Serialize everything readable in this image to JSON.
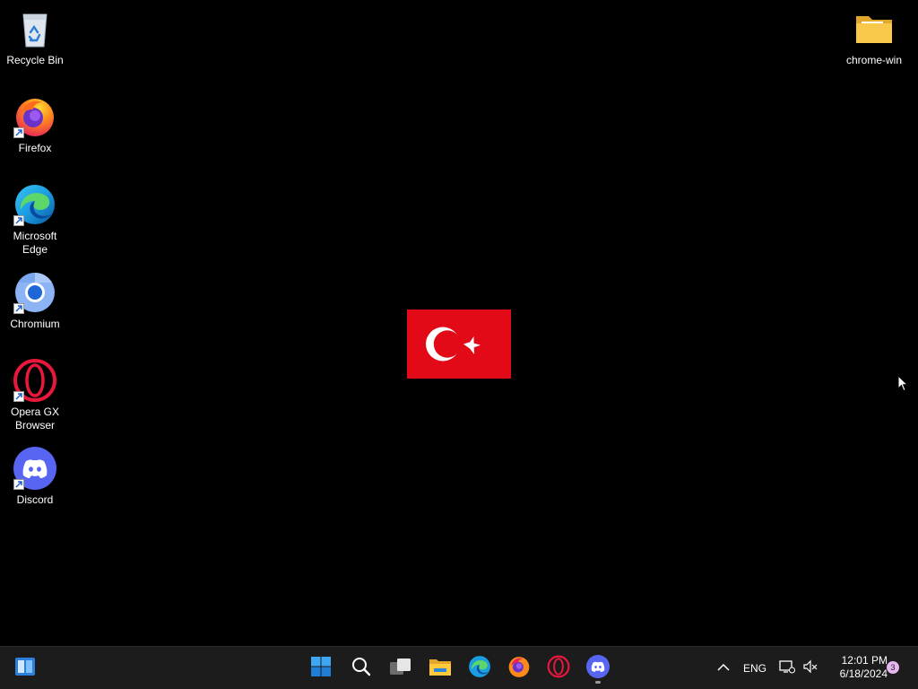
{
  "desktop": {
    "icons": [
      {
        "label": "Recycle Bin",
        "icon": "recycle-bin-icon",
        "shortcut": false
      },
      {
        "label": "Firefox",
        "icon": "firefox-icon",
        "shortcut": true
      },
      {
        "label": "Microsoft Edge",
        "icon": "edge-icon",
        "shortcut": true
      },
      {
        "label": "Chromium",
        "icon": "chromium-icon",
        "shortcut": true
      },
      {
        "label": "Opera GX Browser",
        "icon": "opera-gx-icon",
        "shortcut": true
      },
      {
        "label": "Discord",
        "icon": "discord-icon",
        "shortcut": true
      },
      {
        "label": "chrome-win",
        "icon": "folder-icon",
        "shortcut": false
      }
    ],
    "wallpaper_image": "turkish-flag",
    "colors": {
      "background": "#000000",
      "flag_red": "#e30a17"
    }
  },
  "taskbar": {
    "widgets_icon": "widgets-icon",
    "pinned": [
      {
        "icon": "start-icon"
      },
      {
        "icon": "search-icon"
      },
      {
        "icon": "task-view-icon"
      },
      {
        "icon": "file-explorer-icon"
      },
      {
        "icon": "edge-icon"
      },
      {
        "icon": "firefox-icon"
      },
      {
        "icon": "opera-gx-icon"
      },
      {
        "icon": "discord-icon",
        "running": true
      }
    ],
    "tray": {
      "chevron_icon": "chevron-up-icon",
      "language": "ENG",
      "network_icon": "network-icon",
      "volume_icon": "volume-muted-icon",
      "time": "12:01 PM",
      "date": "6/18/2024",
      "notification_count": "3"
    },
    "colors": {
      "background": "#1c1c1c"
    }
  }
}
